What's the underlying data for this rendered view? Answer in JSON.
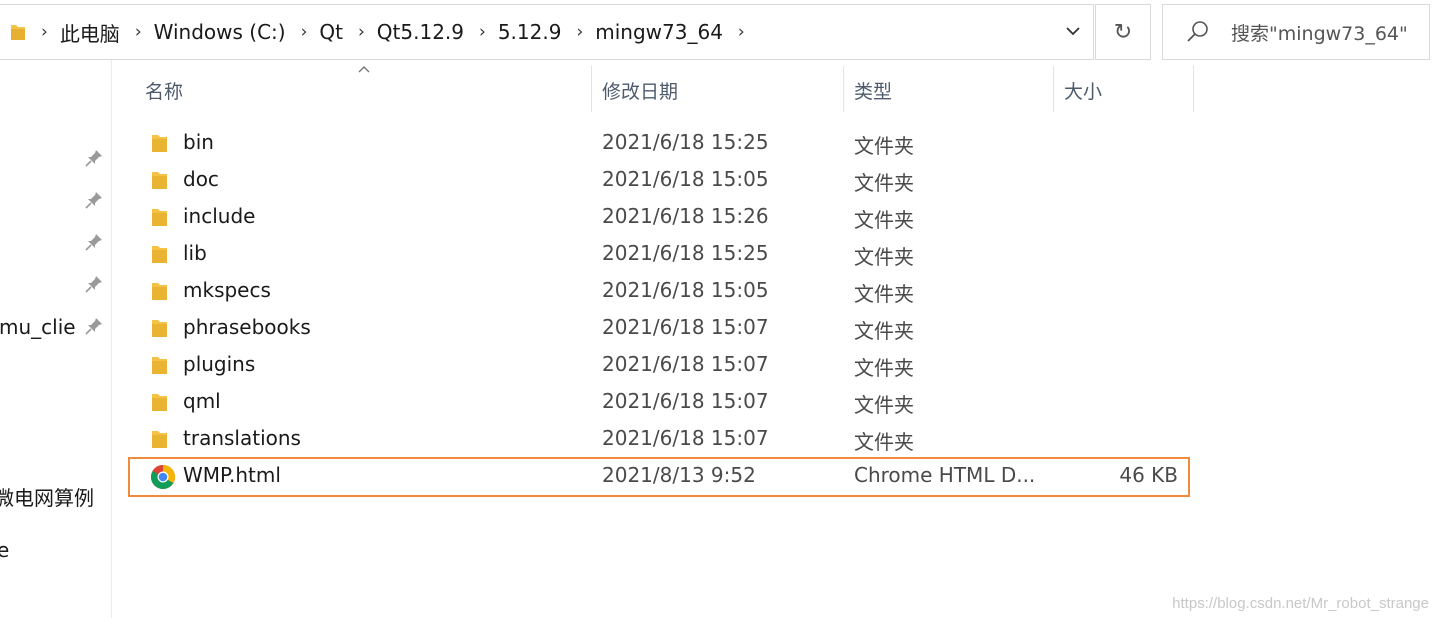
{
  "address_bar": {
    "crumbs": [
      "此电脑",
      "Windows (C:)",
      "Qt",
      "Qt5.12.9",
      "5.12.9",
      "mingw73_64"
    ],
    "dropdown_icon": "chevron-down-icon"
  },
  "refresh": {
    "icon": "refresh-icon",
    "glyph": "↻"
  },
  "search": {
    "placeholder": "搜索\"mingw73_64\"",
    "icon": "search-icon"
  },
  "nav": {
    "items": [
      {
        "label": "",
        "pinned": true
      },
      {
        "label": "",
        "pinned": true
      },
      {
        "label": "",
        "pinned": true
      },
      {
        "label": "",
        "pinned": true
      },
      {
        "label": "mu_clie",
        "pinned": true
      },
      {
        "label": "微电网算例",
        "pinned": false
      },
      {
        "label": "e",
        "pinned": false
      }
    ]
  },
  "columns": {
    "name": "名称",
    "modified": "修改日期",
    "type": "类型",
    "size": "大小"
  },
  "files": [
    {
      "name": "bin",
      "modified": "2021/6/18 15:25",
      "type": "文件夹",
      "size": "",
      "icon": "folder-icon"
    },
    {
      "name": "doc",
      "modified": "2021/6/18 15:05",
      "type": "文件夹",
      "size": "",
      "icon": "folder-icon"
    },
    {
      "name": "include",
      "modified": "2021/6/18 15:26",
      "type": "文件夹",
      "size": "",
      "icon": "folder-icon"
    },
    {
      "name": "lib",
      "modified": "2021/6/18 15:25",
      "type": "文件夹",
      "size": "",
      "icon": "folder-icon"
    },
    {
      "name": "mkspecs",
      "modified": "2021/6/18 15:05",
      "type": "文件夹",
      "size": "",
      "icon": "folder-icon"
    },
    {
      "name": "phrasebooks",
      "modified": "2021/6/18 15:07",
      "type": "文件夹",
      "size": "",
      "icon": "folder-icon"
    },
    {
      "name": "plugins",
      "modified": "2021/6/18 15:07",
      "type": "文件夹",
      "size": "",
      "icon": "folder-icon"
    },
    {
      "name": "qml",
      "modified": "2021/6/18 15:07",
      "type": "文件夹",
      "size": "",
      "icon": "folder-icon"
    },
    {
      "name": "translations",
      "modified": "2021/6/18 15:07",
      "type": "文件夹",
      "size": "",
      "icon": "folder-icon"
    },
    {
      "name": "WMP.html",
      "modified": "2021/8/13 9:52",
      "type": "Chrome HTML D...",
      "size": "46 KB",
      "icon": "chrome-icon",
      "selected": true
    }
  ],
  "watermark": "https://blog.csdn.net/Mr_robot_strange",
  "colors": {
    "selection_border": "#f08a3c",
    "folder": "#f4c244",
    "header_text": "#4d5b6d"
  }
}
